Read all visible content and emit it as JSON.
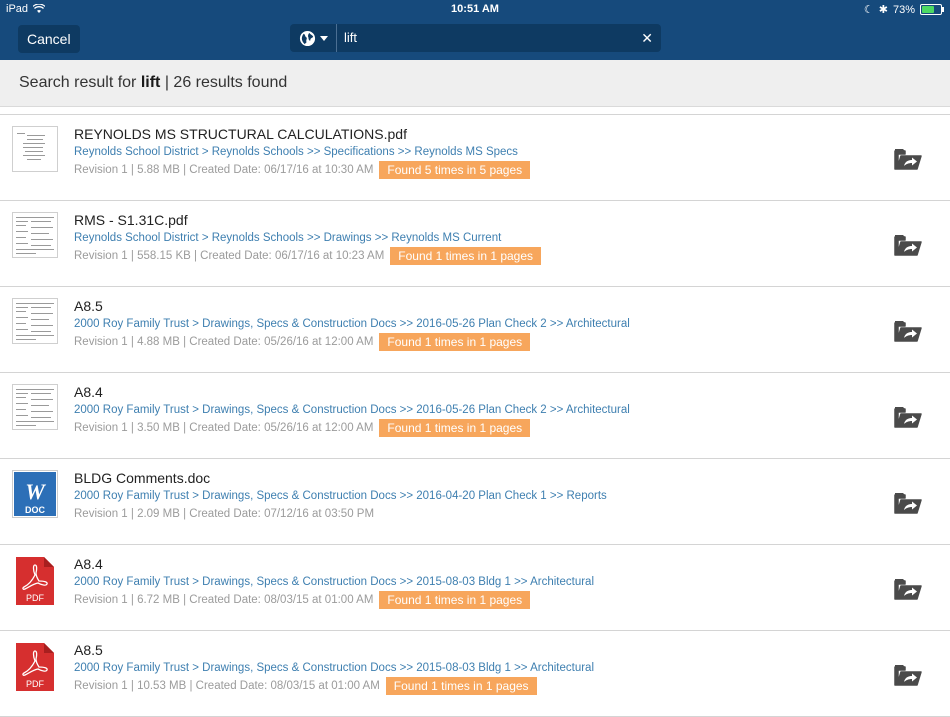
{
  "status_bar": {
    "device": "iPad",
    "time": "10:51 AM",
    "battery": "73%",
    "battery_level": 0.73
  },
  "nav": {
    "cancel_label": "Cancel",
    "search_query": "lift",
    "scope_icon": "globe-icon",
    "clear_icon": "close-icon"
  },
  "summary": {
    "prefix": "Search result for ",
    "term": "lift",
    "separator": " | ",
    "count_text": "26 results found"
  },
  "results": [
    {
      "name": "REYNOLDS MS STRUCTURAL CALCULATIONS.pdf",
      "path": "Reynolds School District > Reynolds Schools >> Specifications >> Reynolds MS Specs",
      "meta": "Revision 1 | 5.88 MB | Created Date: 06/17/16 at 10:30 AM",
      "badge": "Found 5 times in 5 pages",
      "thumb": "document-thumbnail"
    },
    {
      "name": "RMS - S1.31C.pdf",
      "path": "Reynolds School District > Reynolds Schools >> Drawings >> Reynolds MS Current",
      "meta": "Revision 1 | 558.15 KB | Created Date: 06/17/16 at 10:23 AM",
      "badge": "Found 1 times in 1 pages",
      "thumb": "drawing-thumbnail"
    },
    {
      "name": "A8.5",
      "path": "2000 Roy Family Trust > Drawings, Specs & Construction Docs >> 2016-05-26 Plan Check 2 >> Architectural",
      "meta": "Revision 1 | 4.88 MB | Created Date: 05/26/16 at 12:00 AM",
      "badge": "Found 1 times in 1 pages",
      "thumb": "drawing-thumbnail"
    },
    {
      "name": "A8.4",
      "path": "2000 Roy Family Trust > Drawings, Specs & Construction Docs >> 2016-05-26 Plan Check 2 >> Architectural",
      "meta": "Revision 1 | 3.50 MB | Created Date: 05/26/16 at 12:00 AM",
      "badge": "Found 1 times in 1 pages",
      "thumb": "drawing-thumbnail"
    },
    {
      "name": "BLDG Comments.doc",
      "path": "2000 Roy Family Trust > Drawings, Specs & Construction Docs >> 2016-04-20 Plan Check 1 >> Reports",
      "meta": "Revision 1 | 2.09 MB | Created Date: 07/12/16 at 03:50 PM",
      "badge": "",
      "thumb": "word-doc-icon",
      "thumb_text": "DOC"
    },
    {
      "name": "A8.4",
      "path": "2000 Roy Family Trust > Drawings, Specs & Construction Docs >> 2015-08-03 Bldg 1 >> Architectural",
      "meta": "Revision 1 | 6.72 MB | Created Date: 08/03/15 at 01:00 AM",
      "badge": "Found 1 times in 1 pages",
      "thumb": "pdf-file-icon",
      "thumb_text": "PDF"
    },
    {
      "name": "A8.5",
      "path": "2000 Roy Family Trust > Drawings, Specs & Construction Docs >> 2015-08-03 Bldg 1 >> Architectural",
      "meta": "Revision 1 | 10.53 MB | Created Date: 08/03/15 at 01:00 AM",
      "badge": "Found 1 times in 1 pages",
      "thumb": "pdf-file-icon",
      "thumb_text": "PDF"
    }
  ],
  "colors": {
    "nav_bg": "#164a7c",
    "path_link": "#3e7fb0",
    "badge_bg": "#f7a65c",
    "pdf_red": "#d62f2f",
    "word_blue": "#2c6fb7"
  }
}
